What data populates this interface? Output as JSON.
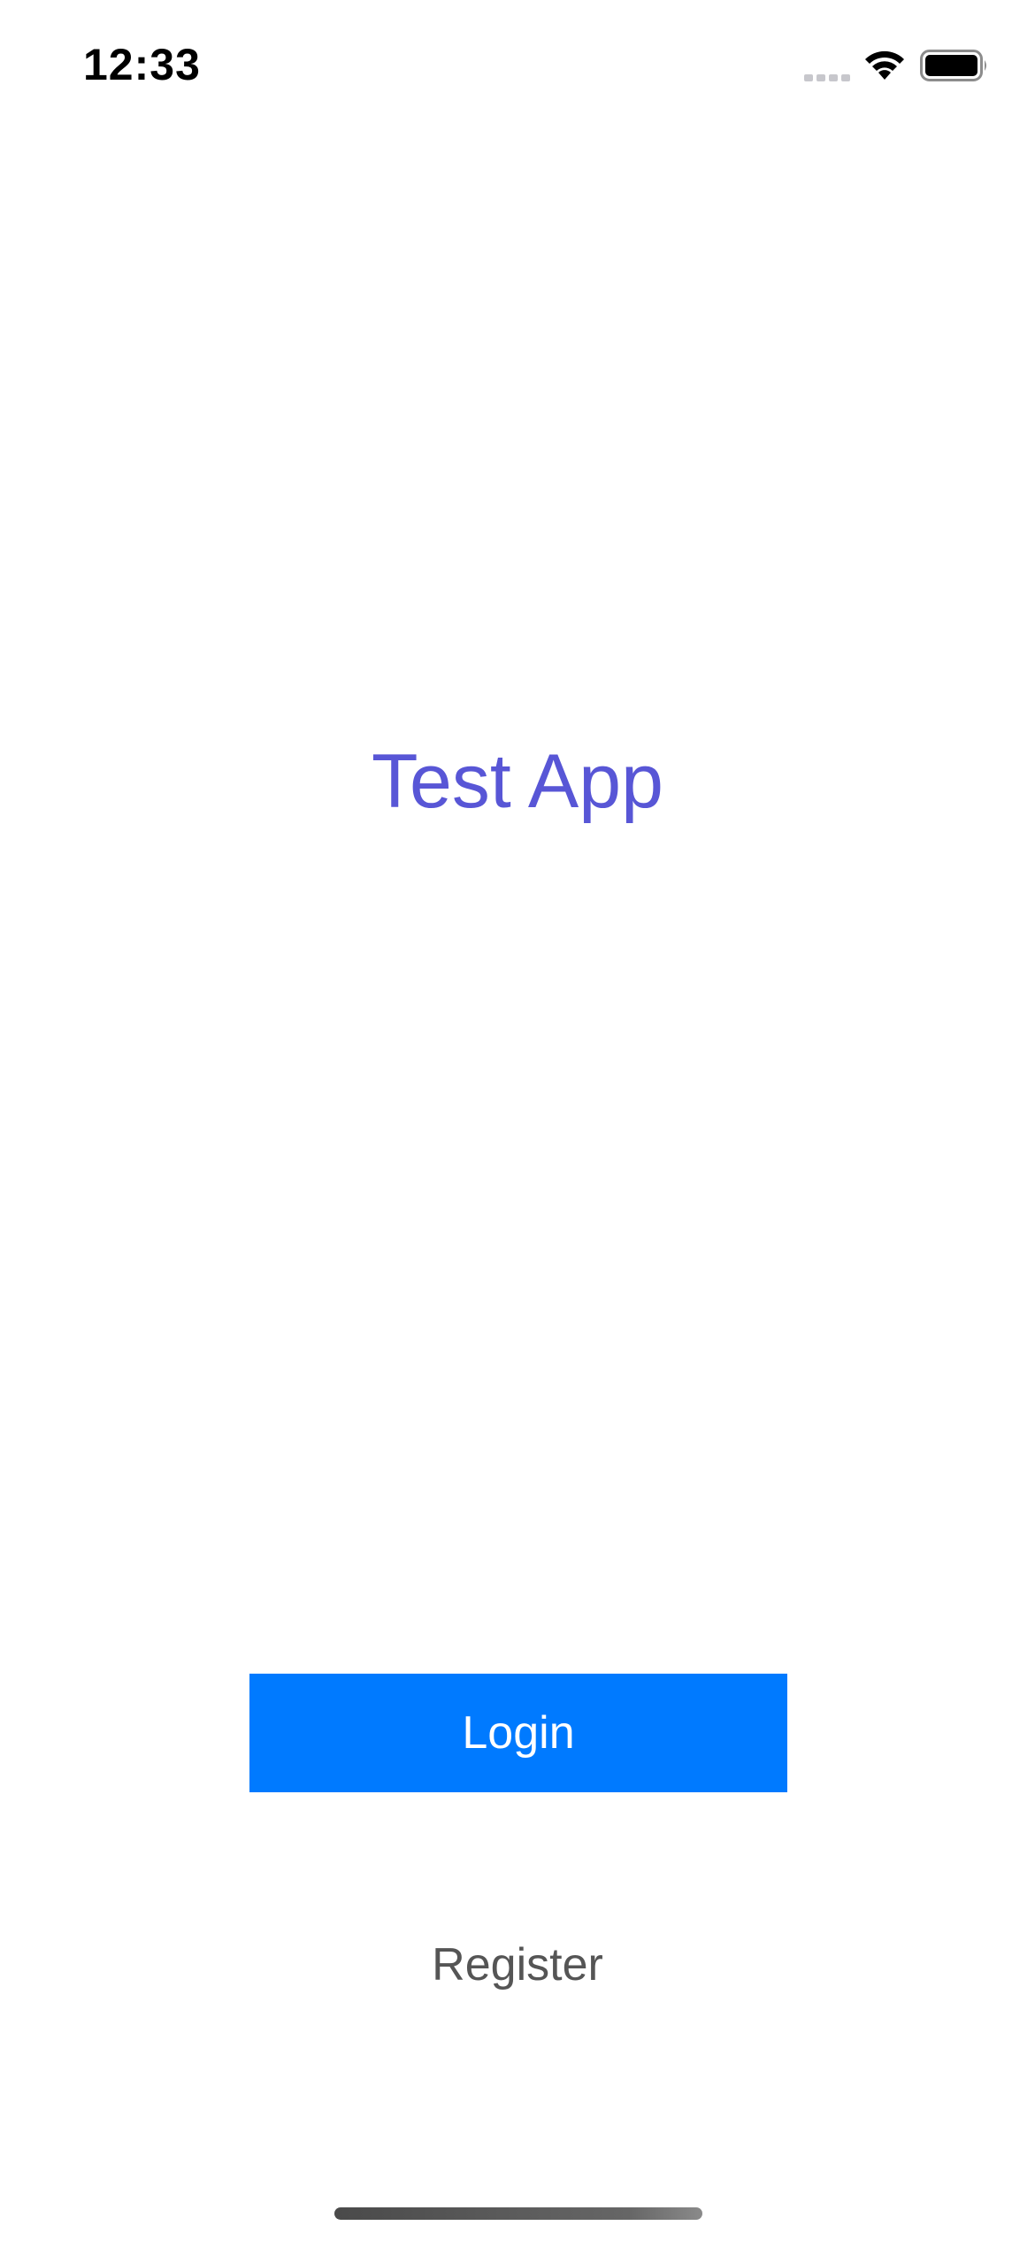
{
  "status_bar": {
    "time": "12:33",
    "signal_icon": "cellular-signal-icon",
    "wifi_icon": "wifi-icon",
    "battery_icon": "battery-icon"
  },
  "app": {
    "title": "Test App"
  },
  "actions": {
    "login_label": "Login",
    "register_label": "Register"
  },
  "colors": {
    "title": "#5856d6",
    "primary_button": "#007aff",
    "register_text": "#555555",
    "background": "#ffffff"
  }
}
